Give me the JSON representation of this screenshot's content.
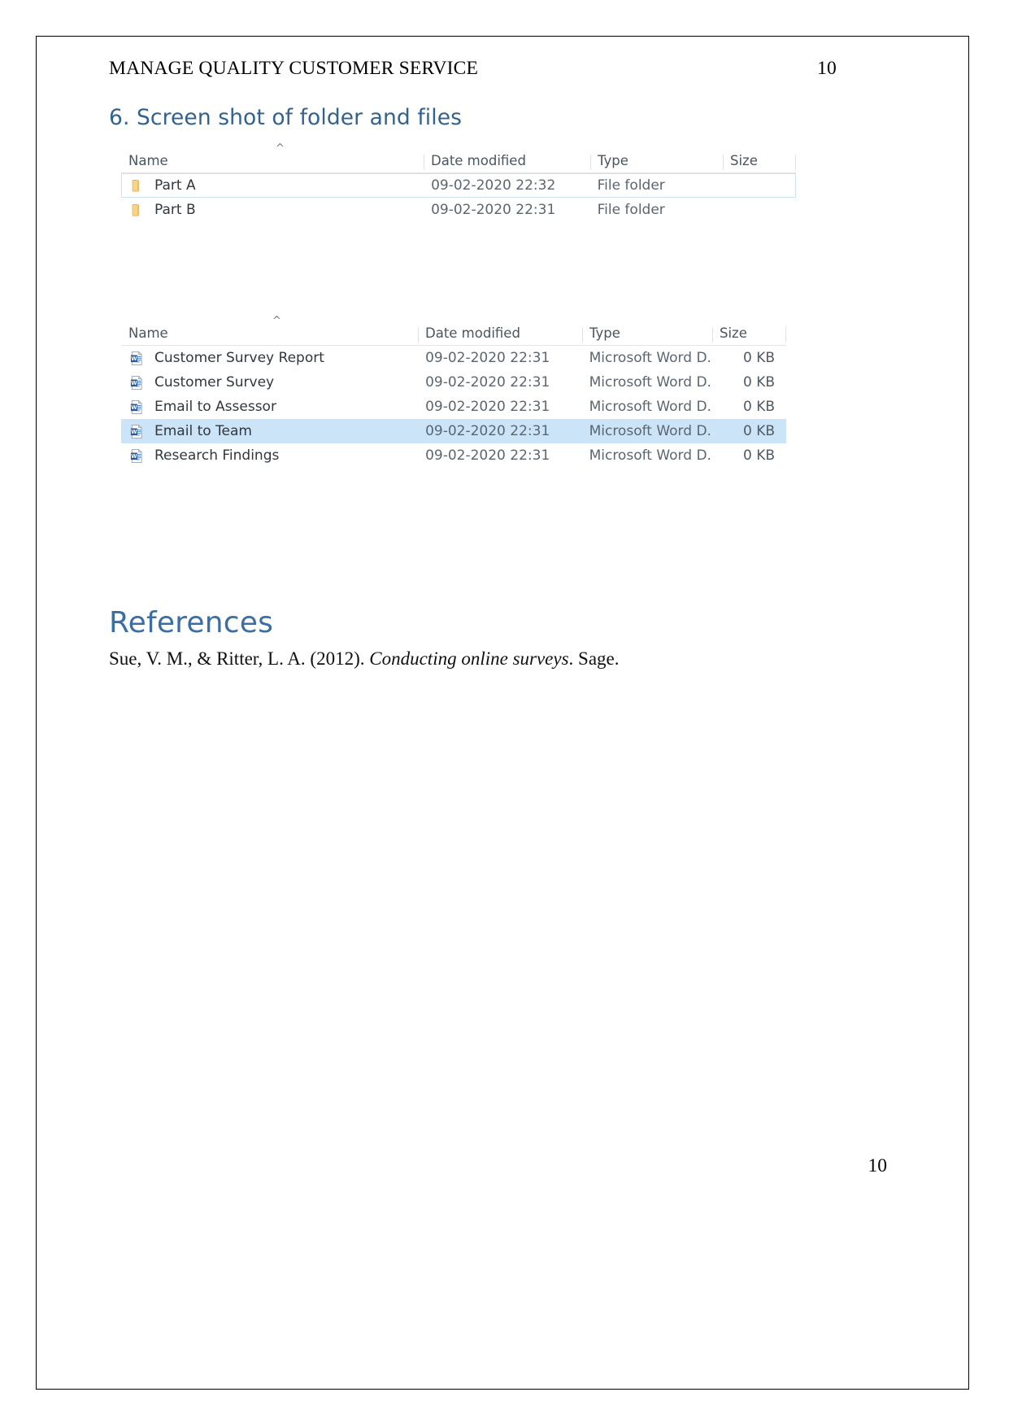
{
  "document": {
    "running_header_title": "MANAGE QUALITY CUSTOMER SERVICE",
    "running_header_page": "10",
    "footer_page": "10"
  },
  "section": {
    "heading": "6. Screen shot of folder and files"
  },
  "references": {
    "heading": "References",
    "citation_prefix": "Sue, V. M., & Ritter, L. A. (2012). ",
    "citation_title": "Conducting online surveys",
    "citation_suffix": ". Sage."
  },
  "explorer_folders": {
    "columns": {
      "name": "Name",
      "date_modified": "Date modified",
      "type": "Type",
      "size": "Size"
    },
    "sort_indicator": "^",
    "sorted_column": "Name",
    "rows": [
      {
        "icon": "folder-icon",
        "name": "Part A",
        "date_modified": "09-02-2020 22:32",
        "type": "File folder",
        "size": "",
        "state": "hovered"
      },
      {
        "icon": "folder-icon",
        "name": "Part B",
        "date_modified": "09-02-2020 22:31",
        "type": "File folder",
        "size": "",
        "state": "normal"
      }
    ]
  },
  "explorer_files": {
    "columns": {
      "name": "Name",
      "date_modified": "Date modified",
      "type": "Type",
      "size": "Size"
    },
    "sort_indicator": "^",
    "sorted_column": "Name",
    "rows": [
      {
        "icon": "word-document-icon",
        "name": "Customer Survey Report",
        "date_modified": "09-02-2020 22:31",
        "type": "Microsoft Word D...",
        "size": "0 KB",
        "state": "normal"
      },
      {
        "icon": "word-document-icon",
        "name": "Customer Survey",
        "date_modified": "09-02-2020 22:31",
        "type": "Microsoft Word D...",
        "size": "0 KB",
        "state": "normal"
      },
      {
        "icon": "word-document-icon",
        "name": "Email to Assessor",
        "date_modified": "09-02-2020 22:31",
        "type": "Microsoft Word D...",
        "size": "0 KB",
        "state": "normal"
      },
      {
        "icon": "word-document-icon",
        "name": "Email to Team",
        "date_modified": "09-02-2020 22:31",
        "type": "Microsoft Word D...",
        "size": "0 KB",
        "state": "selected"
      },
      {
        "icon": "word-document-icon",
        "name": "Research Findings",
        "date_modified": "09-02-2020 22:31",
        "type": "Microsoft Word D...",
        "size": "0 KB",
        "state": "normal"
      }
    ]
  },
  "colors": {
    "heading_blue": "#33628f",
    "references_blue": "#3a6ea5",
    "selection_blue": "#cce4f7",
    "hover_border_blue": "#cce3f5",
    "folder_yellow": "#f5cf7a",
    "word_blue": "#2b579a"
  }
}
